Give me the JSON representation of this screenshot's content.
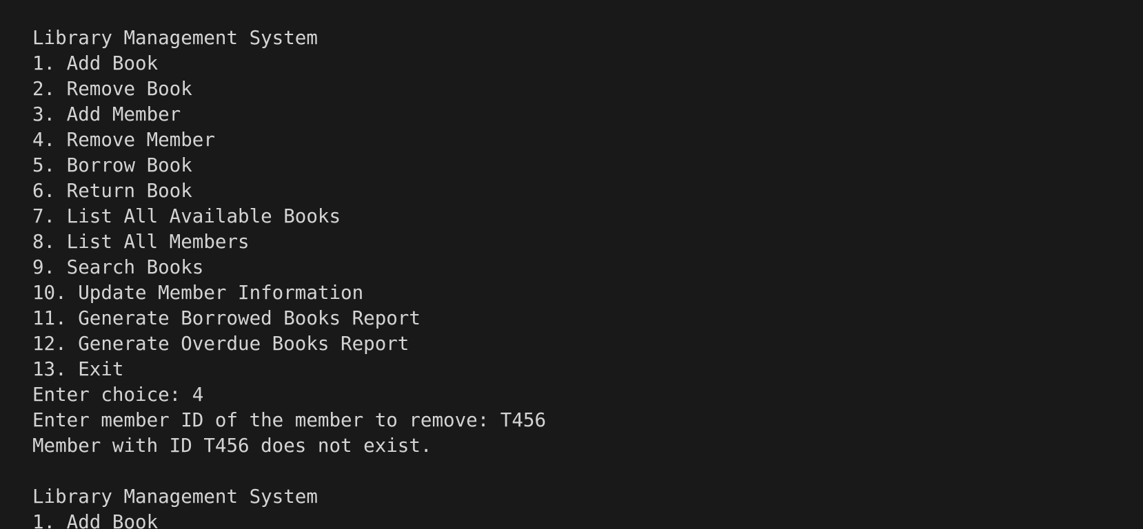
{
  "session1": {
    "title": "Library Management System",
    "menu": [
      "1. Add Book",
      "2. Remove Book",
      "3. Add Member",
      "4. Remove Member",
      "5. Borrow Book",
      "6. Return Book",
      "7. List All Available Books",
      "8. List All Members",
      "9. Search Books",
      "10. Update Member Information",
      "11. Generate Borrowed Books Report",
      "12. Generate Overdue Books Report",
      "13. Exit"
    ],
    "choice_prompt": "Enter choice: 4",
    "member_prompt": "Enter member ID of the member to remove: T456",
    "result": "Member with ID T456 does not exist."
  },
  "session2": {
    "title": "Library Management System",
    "menu": [
      "1. Add Book"
    ]
  }
}
